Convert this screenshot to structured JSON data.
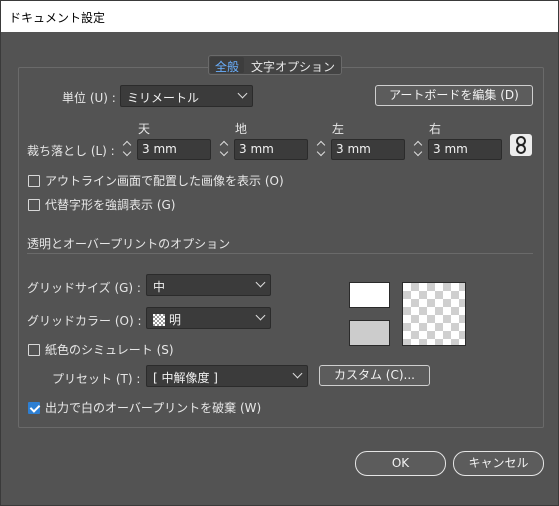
{
  "window": {
    "title": "ドキュメント設定"
  },
  "tabs": [
    {
      "label": "全般"
    },
    {
      "label": "文字オプション"
    }
  ],
  "units": {
    "label": "単位 (U) :",
    "value": "ミリメートル"
  },
  "edit_artboards_label": "アートボードを編集 (D)",
  "bleed": {
    "label": "裁ち落とし (L) :",
    "top": {
      "label": "天",
      "value": "3 mm"
    },
    "bottom": {
      "label": "地",
      "value": "3 mm"
    },
    "left": {
      "label": "左",
      "value": "3 mm"
    },
    "right": {
      "label": "右",
      "value": "3 mm"
    }
  },
  "checkboxes": {
    "outline_images": {
      "label": "アウトライン画面で配置した画像を表示 (O)",
      "checked": false
    },
    "substituted_glyphs": {
      "label": "代替字形を強調表示 (G)",
      "checked": false
    },
    "simulate_paper": {
      "label": "紙色のシミュレート (S)",
      "checked": false
    },
    "discard_white_overprint": {
      "label": "出力で白のオーバープリントを破棄 (W)",
      "checked": true
    }
  },
  "transparency": {
    "section_label": "透明とオーバープリントのオプション",
    "grid_size": {
      "label": "グリッドサイズ (G) :",
      "value": "中"
    },
    "grid_color": {
      "label": "グリッドカラー (O) :",
      "value": "明"
    },
    "preset": {
      "label": "プリセット (T) :",
      "value": "[ 中解像度 ]"
    },
    "custom_label": "カスタム (C)..."
  },
  "buttons": {
    "ok": "OK",
    "cancel": "キャンセル"
  },
  "colors": {
    "accent": "#2d7fd3",
    "tab_active": "#6ab0ff",
    "background": "#535353"
  }
}
